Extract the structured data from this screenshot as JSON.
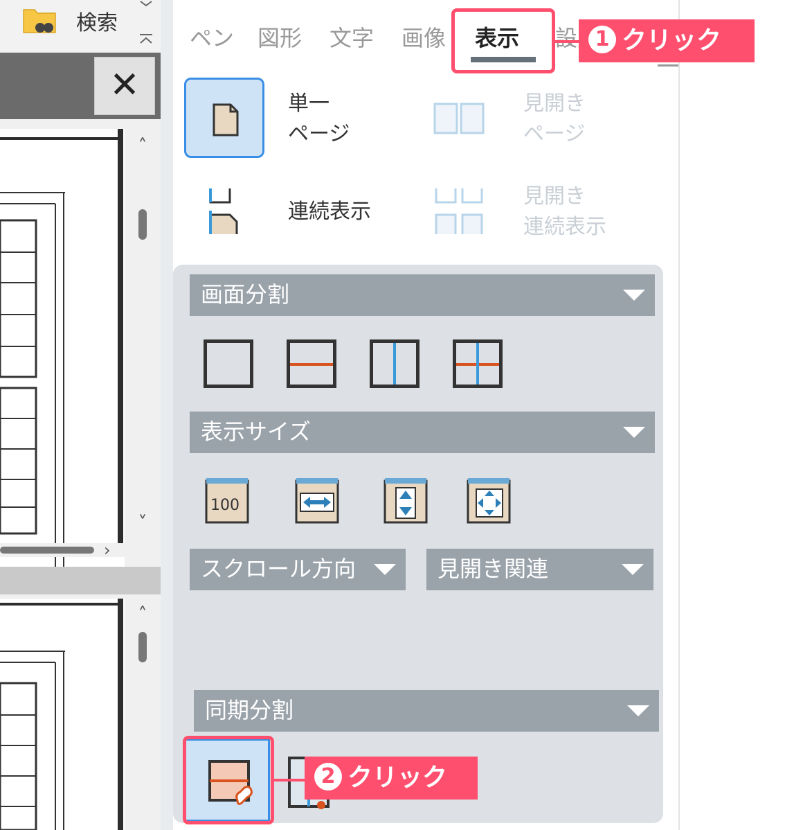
{
  "toolbar": {
    "search_label": "検索",
    "close_label": "✕"
  },
  "tabs": [
    {
      "label": "ペン",
      "active": false
    },
    {
      "label": "図形",
      "active": false
    },
    {
      "label": "文字",
      "active": false
    },
    {
      "label": "画像",
      "active": false
    },
    {
      "label": "表示",
      "active": true
    },
    {
      "label": "設定",
      "active": false
    }
  ],
  "page_view": {
    "single_page": "単一\nページ",
    "spread_page": "見開き\nページ",
    "continuous": "連続表示",
    "spread_continuous": "見開き\n連続表示"
  },
  "screen_split": {
    "header": "画面分割",
    "icons": [
      "split-none-icon",
      "split-horizontal-icon",
      "split-vertical-icon",
      "split-quad-icon"
    ]
  },
  "display_size": {
    "header": "表示サイズ",
    "icons": [
      "zoom-100-icon",
      "fit-width-icon",
      "fit-height-icon",
      "fit-page-icon"
    ],
    "zoom_label": "100"
  },
  "scroll_direction": {
    "header": "スクロール方向"
  },
  "spread_related": {
    "header": "見開き関連"
  },
  "sync_split": {
    "header": "同期分割",
    "icons": [
      "sync-split-horizontal-icon",
      "sync-split-vertical-icon"
    ]
  },
  "callouts": [
    {
      "number": "1",
      "text": "クリック"
    },
    {
      "number": "2",
      "text": "クリック"
    }
  ],
  "colors": {
    "accent": "#ff4f6e",
    "selected_bg": "#cfe3f6",
    "selected_border": "#3a8ee6",
    "header_bg": "#9aa2aa",
    "split_line": "#d9531e",
    "split_line_blue": "#3a9ad9"
  }
}
